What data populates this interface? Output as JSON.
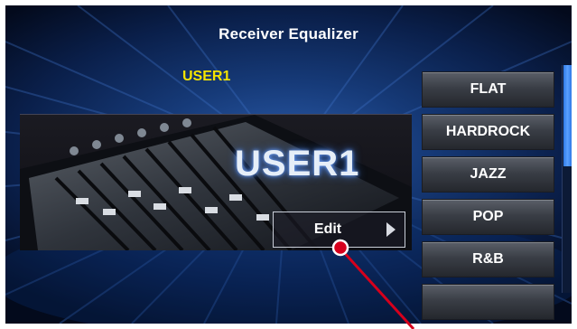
{
  "window": {
    "title": "Receiver Equalizer"
  },
  "current_preset": {
    "name": "USER1",
    "image_label": "USER1",
    "name_color": "#f5e400"
  },
  "edit_button": {
    "label": "Edit"
  },
  "presets": [
    {
      "label": "FLAT"
    },
    {
      "label": "HARDROCK"
    },
    {
      "label": "JAZZ"
    },
    {
      "label": "POP"
    },
    {
      "label": "R&B"
    },
    {
      "label": ""
    }
  ],
  "colors": {
    "background": "#163a78",
    "accent": "#5aa0ff",
    "pointer": "#d6001c"
  },
  "icons": {
    "edit_arrow": "chevron-right-icon",
    "callout": "callout-marker-icon"
  }
}
